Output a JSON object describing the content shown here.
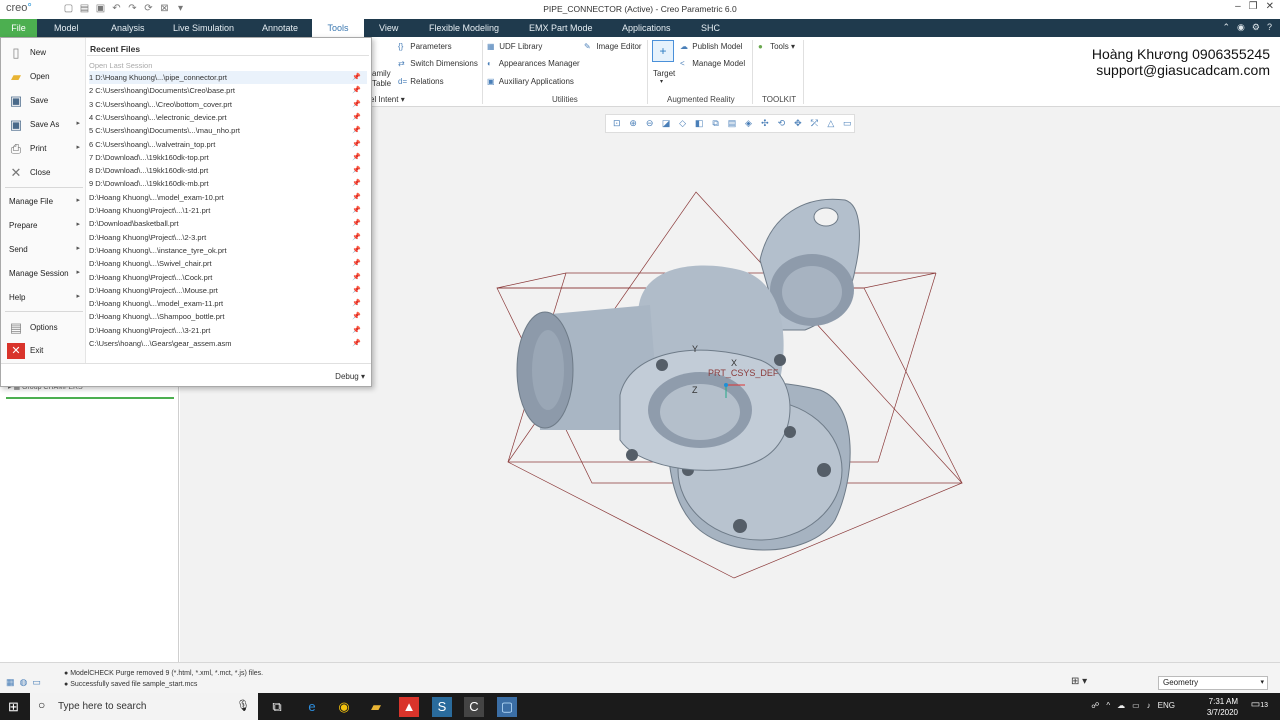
{
  "window": {
    "title": "PIPE_CONNECTOR (Active) - Creo Parametric 6.0",
    "logo_prefix": "creo",
    "logo_suffix": "°"
  },
  "tabs": [
    "File",
    "Model",
    "Analysis",
    "Live Simulation",
    "Annotate",
    "Tools",
    "View",
    "Flexible Modeling",
    "EMX Part Mode",
    "Applications",
    "SHC"
  ],
  "active_tab": "Tools",
  "ribbon": {
    "partial_left_top": "amily",
    "partial_left_bottom": "Table",
    "intent_label": "el Intent",
    "parameters": "Parameters",
    "switch_dimensions": "Switch Dimensions",
    "relations": "Relations",
    "udf_library": "UDF Library",
    "appearances_manager": "Appearances Manager",
    "auxiliary_applications": "Auxiliary Applications",
    "image_editor": "Image Editor",
    "target": "Target",
    "publish_model": "Publish Model",
    "manage_model": "Manage Model",
    "tools_button": "Tools",
    "group_utilities": "Utilities",
    "group_augmented_reality": "Augmented Reality",
    "group_toolkit": "TOOLKIT"
  },
  "brand": {
    "line1": "Hoàng Khương 0906355245",
    "line2": "support@giasucadcam.com"
  },
  "file_menu": {
    "items": [
      {
        "label": "New",
        "icon": "new-icon"
      },
      {
        "label": "Open",
        "icon": "folder-open-icon"
      },
      {
        "label": "Save",
        "icon": "save-icon"
      },
      {
        "label": "Save As",
        "icon": "save-as-icon"
      },
      {
        "label": "Print",
        "icon": "print-icon"
      },
      {
        "label": "Close",
        "icon": "close-icon"
      }
    ],
    "sub_items": [
      "Manage File",
      "Prepare",
      "Send",
      "Manage Session",
      "Help"
    ],
    "options": "Options",
    "exit": "Exit",
    "recent_title": "Recent Files",
    "open_last_session": "Open Last Session",
    "recent_files": [
      "1 D:\\Hoang Khuong\\...\\pipe_connector.prt",
      "2 C:\\Users\\hoang\\Documents\\Creo\\base.prt",
      "3 C:\\Users\\hoang\\...\\Creo\\bottom_cover.prt",
      "4 C:\\Users\\hoang\\...\\electronic_device.prt",
      "5 C:\\Users\\hoang\\Documents\\...\\mau_nho.prt",
      "6 C:\\Users\\hoang\\...\\valvetrain_top.prt",
      "7 D:\\Download\\...\\19kk160dk-top.prt",
      "8 D:\\Download\\...\\19kk160dk-std.prt",
      "9 D:\\Download\\...\\19kk160dk-mb.prt",
      "D:\\Hoang Khuong\\...\\model_exam-10.prt",
      "D:\\Hoang Khuong\\Project\\...\\1-21.prt",
      "D:\\Download\\basketball.prt",
      "D:\\Hoang Khuong\\Project\\...\\2-3.prt",
      "D:\\Hoang Khuong\\...\\instance_tyre_ok.prt",
      "D:\\Hoang Khuong\\...\\Swivel_chair.prt",
      "D:\\Hoang Khuong\\Project\\...\\Cock.prt",
      "D:\\Hoang Khuong\\Project\\...\\Mouse.prt",
      "D:\\Hoang Khuong\\...\\model_exam-11.prt",
      "D:\\Hoang Khuong\\...\\Shampoo_bottle.prt",
      "D:\\Hoang Khuong\\Project\\...\\3-21.prt",
      "C:\\Users\\hoang\\...\\Gears\\gear_assem.asm"
    ],
    "debug": "Debug"
  },
  "tree": {
    "group_item": "Group CHAMFERS"
  },
  "graphics": {
    "csys_label": "PRT_CSYS_DEF",
    "axis_x": "X",
    "axis_y": "Y",
    "axis_z": "Z"
  },
  "status": {
    "msg1": "ModelCHECK Purge removed 9 (*.html, *.xml, *.mct, *.js) files.",
    "msg2": "Successfully saved file sample_start.mcs",
    "filter_value": "Geometry"
  },
  "taskbar": {
    "search_placeholder": "Type here to search",
    "lang": "ENG",
    "time": "7:31 AM",
    "date": "3/7/2020",
    "notification_count": "13"
  },
  "colors": {
    "file_tab": "#4caf50",
    "tab_bar": "#1f3a4d",
    "model_body": "#a9b6c4"
  }
}
